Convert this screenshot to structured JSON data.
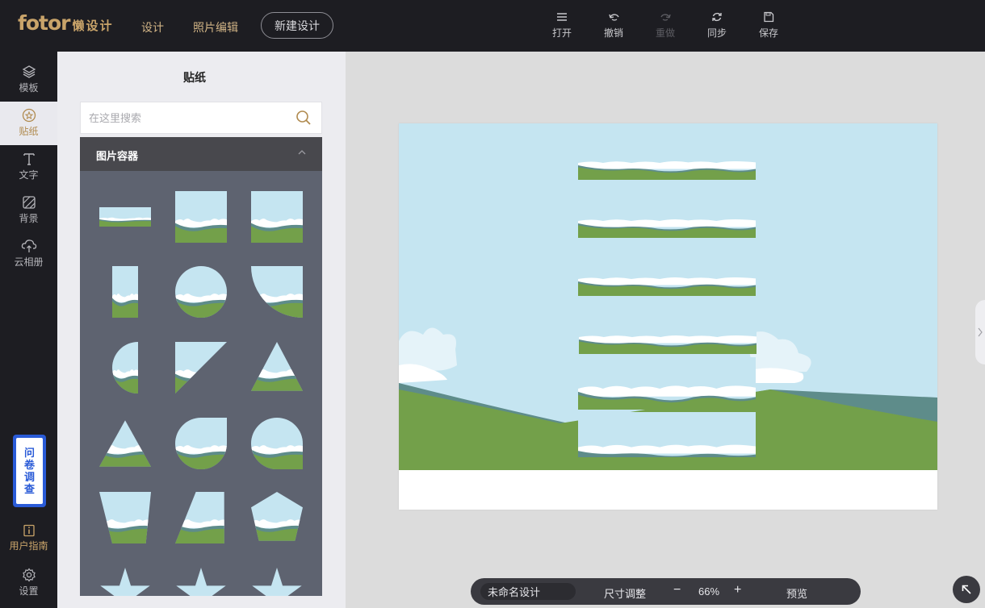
{
  "header": {
    "logo_brand": "fotor",
    "logo_sub": "懒设计",
    "nav": {
      "design": "设计",
      "photo_edit": "照片编辑"
    },
    "new_design": "新建设计",
    "tools": {
      "open": "打开",
      "undo": "撤销",
      "redo": "重做",
      "sync": "同步",
      "save": "保存"
    }
  },
  "sidebar": {
    "items": [
      {
        "label": "模板",
        "icon": "layers-icon"
      },
      {
        "label": "贴纸",
        "icon": "sticker-icon"
      },
      {
        "label": "文字",
        "icon": "text-icon"
      },
      {
        "label": "背景",
        "icon": "background-icon"
      },
      {
        "label": "云相册",
        "icon": "cloud-upload-icon"
      }
    ],
    "active": "贴纸",
    "survey": [
      "问",
      "卷",
      "调",
      "查"
    ],
    "guide": "用户指南",
    "settings": "设置"
  },
  "panel": {
    "title": "贴纸",
    "search_placeholder": "在这里搜索",
    "category": "图片容器",
    "frames": [
      "wide-rectangle",
      "square",
      "square",
      "tall-rectangle",
      "circle",
      "quarter-cut",
      "half-circle",
      "triangle-diagonal",
      "triangle",
      "triangle",
      "teardrop",
      "rounded-arch",
      "trapezoid",
      "parallelogram",
      "pentagon",
      "star",
      "star",
      "star"
    ]
  },
  "canvas": {
    "colors": {
      "sky": "#c5e5f1",
      "grass": "#73a04a",
      "hill": "#5e8c8a",
      "cloud": "#ffffff"
    }
  },
  "bottombar": {
    "design_name": "未命名设计",
    "resize": "尺寸调整",
    "zoom_out": "−",
    "zoom": "66%",
    "zoom_in": "+",
    "preview": "预览"
  },
  "colors": {
    "accent": "#c9a46a",
    "topbar": "#1d1d22",
    "survey": "#2a5bd7"
  }
}
